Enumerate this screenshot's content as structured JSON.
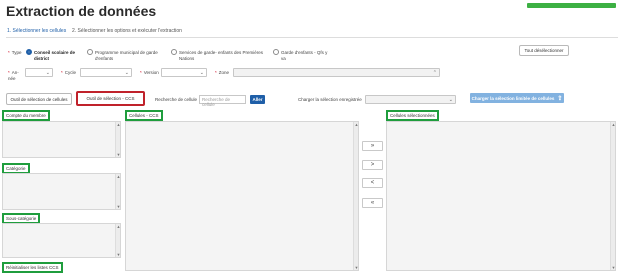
{
  "page": {
    "title": "Extraction de données"
  },
  "tabs": [
    {
      "label": "1. Sélectionner les cellules"
    },
    {
      "label": "2. Sélectionner les options et exécuter l'extraction"
    }
  ],
  "toolbar": {
    "deselect_all": "Tout désélectionner"
  },
  "type": {
    "label": "Type",
    "options": [
      {
        "label": "Conseil scolaire de district",
        "checked": true
      },
      {
        "label": "Programme municipal de garde d'enfants",
        "checked": false
      },
      {
        "label": "Services de garde- enfants des Premières Nations",
        "checked": false
      },
      {
        "label": "Garde d'enfants - Qfs y va",
        "checked": false
      }
    ]
  },
  "filters": {
    "annee": "An- née",
    "cycle": "Cycle",
    "version": "Version",
    "zone": "Zone"
  },
  "tools": {
    "cells_tool": "Outil de sélection de cellules",
    "ccs_tool": "Outil de sélection - CCS",
    "search_label": "Recherche de cellule",
    "search_placeholder": "Recherche de cellule",
    "go": "Aller",
    "load_label": "Charger la sélection enregistrée",
    "load_button": "Charger la sélection limitée de cellules"
  },
  "panels": {
    "account": "Compte du membre",
    "category": "Catégorie",
    "subcategory": "Sous-catégorie",
    "reset": "Réinitialiser les listes CCS",
    "cells": "Cellules - CCS",
    "selected": "Cellules sélectionnées"
  },
  "transfer": {
    "add_all": "»",
    "add": ">",
    "remove": "<",
    "remove_all": "«"
  },
  "colors": {
    "accent": "#1f5fa8",
    "progress": "#3cb043",
    "highlight_green": "#1f9d3d",
    "highlight_red": "#c0222b"
  }
}
